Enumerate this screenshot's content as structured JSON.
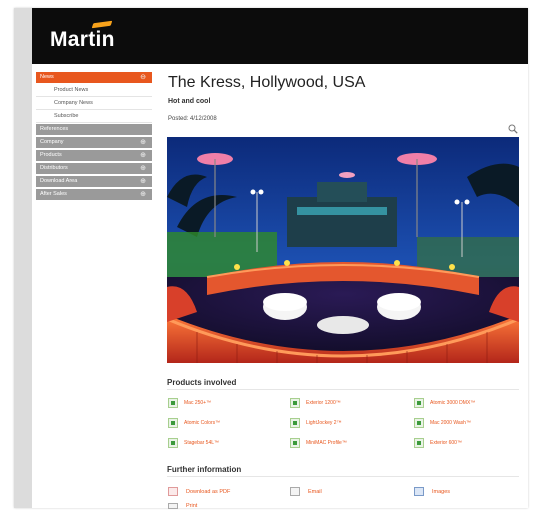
{
  "brand": {
    "logo": "Martin",
    "accent": "#e8571e",
    "logo_mark_color": "#f7a21b"
  },
  "sidebar": {
    "items": [
      {
        "label": "News",
        "active": true
      },
      {
        "label": "Product News",
        "sub": true
      },
      {
        "label": "Company News",
        "sub": true
      },
      {
        "label": "Subscribe",
        "sub": true
      },
      {
        "label": "References"
      },
      {
        "label": "Company"
      },
      {
        "label": "Products"
      },
      {
        "label": "Distributors"
      },
      {
        "label": "Download Area"
      },
      {
        "label": "After Sales"
      }
    ]
  },
  "article": {
    "title": "The Kress, Hollywood, USA",
    "subtitle": "Hot and cool",
    "date": "Posted: 4/12/2008"
  },
  "products": {
    "title": "Products involved",
    "items": [
      "Mac 250+™",
      "Exterior 1200™",
      "Atomic 3000 DMX™",
      "Atomic Colors™",
      "LightJockey 2™",
      "Mac 2000 Wash™",
      "Stagebar 54L™",
      "MiniMAC Profile™",
      "Exterior 600™"
    ]
  },
  "further": {
    "title": "Further information",
    "items": [
      "Download as PDF",
      "Email",
      "Images",
      "Print"
    ]
  }
}
